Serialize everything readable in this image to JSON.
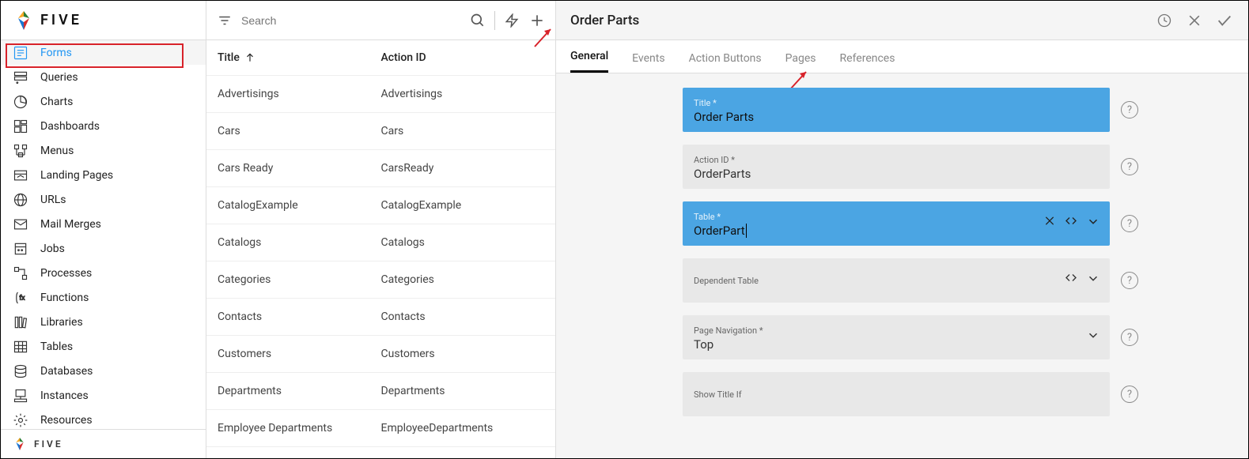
{
  "logo": {
    "text": "FIVE",
    "footer_text": "FIVE"
  },
  "sidebar": {
    "items": [
      {
        "label": "Forms",
        "icon": "form"
      },
      {
        "label": "Queries",
        "icon": "query"
      },
      {
        "label": "Charts",
        "icon": "chart"
      },
      {
        "label": "Dashboards",
        "icon": "dashboard"
      },
      {
        "label": "Menus",
        "icon": "menu"
      },
      {
        "label": "Landing Pages",
        "icon": "landing"
      },
      {
        "label": "URLs",
        "icon": "url"
      },
      {
        "label": "Mail Merges",
        "icon": "mail"
      },
      {
        "label": "Jobs",
        "icon": "jobs"
      },
      {
        "label": "Processes",
        "icon": "process"
      },
      {
        "label": "Functions",
        "icon": "fx"
      },
      {
        "label": "Libraries",
        "icon": "lib"
      },
      {
        "label": "Tables",
        "icon": "table"
      },
      {
        "label": "Databases",
        "icon": "db"
      },
      {
        "label": "Instances",
        "icon": "instance"
      },
      {
        "label": "Resources",
        "icon": "resource"
      }
    ],
    "active_index": 0
  },
  "list": {
    "search_placeholder": "Search",
    "header_title": "Title",
    "header_action": "Action ID",
    "rows": [
      {
        "title": "Advertisings",
        "action": "Advertisings"
      },
      {
        "title": "Cars",
        "action": "Cars"
      },
      {
        "title": "Cars Ready",
        "action": "CarsReady"
      },
      {
        "title": "CatalogExample",
        "action": "CatalogExample"
      },
      {
        "title": "Catalogs",
        "action": "Catalogs"
      },
      {
        "title": "Categories",
        "action": "Categories"
      },
      {
        "title": "Contacts",
        "action": "Contacts"
      },
      {
        "title": "Customers",
        "action": "Customers"
      },
      {
        "title": "Departments",
        "action": "Departments"
      },
      {
        "title": "Employee Departments",
        "action": "EmployeeDepartments"
      }
    ]
  },
  "detail": {
    "title": "Order Parts",
    "tabs": [
      "General",
      "Events",
      "Action Buttons",
      "Pages",
      "References"
    ],
    "active_tab": 0,
    "fields": {
      "f1": {
        "label": "Title *",
        "value": "Order Parts",
        "style": "blue",
        "icons": []
      },
      "f2": {
        "label": "Action ID *",
        "value": "OrderParts",
        "style": "grey",
        "icons": []
      },
      "f3": {
        "label": "Table *",
        "value": "OrderPart",
        "style": "blue",
        "icons": [
          "clear",
          "code",
          "chev"
        ],
        "cursor": true
      },
      "f4": {
        "label": "Dependent Table",
        "value": "",
        "style": "grey",
        "icons": [
          "code",
          "chev"
        ]
      },
      "f5": {
        "label": "Page Navigation *",
        "value": "Top",
        "style": "grey",
        "icons": [
          "chev"
        ]
      },
      "f6": {
        "label": "Show Title If",
        "value": "",
        "style": "grey",
        "icons": []
      }
    }
  }
}
